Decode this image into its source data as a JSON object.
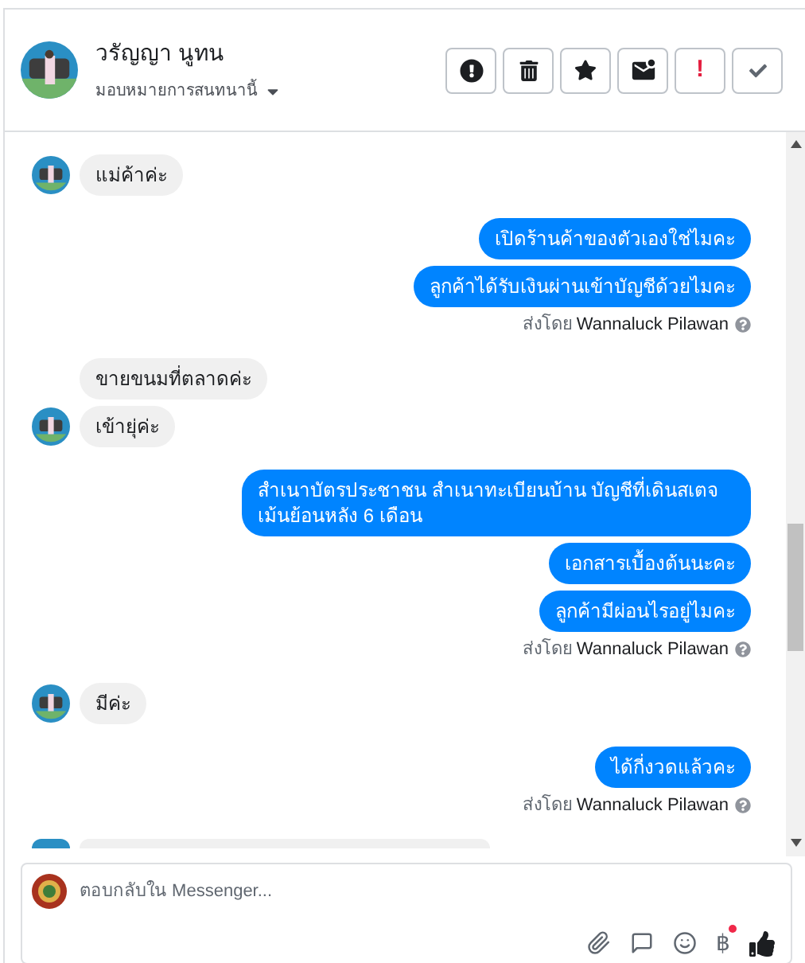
{
  "header": {
    "name": "วรัญญา นูทน",
    "assign_label": "มอบหมายการสนทนานี้",
    "actions": [
      {
        "kind": "alert"
      },
      {
        "kind": "trash"
      },
      {
        "kind": "star"
      },
      {
        "kind": "mail"
      },
      {
        "kind": "spam",
        "text": "!"
      },
      {
        "kind": "done"
      }
    ]
  },
  "messages": [
    {
      "kind": "incoming",
      "text": "แม่ค้าค่ะ",
      "avatar": true
    },
    {
      "kind": "outgoing",
      "text": "เปิดร้านค้าของตัวเองใช่ไมคะ"
    },
    {
      "kind": "outgoing",
      "text": "ลูกค้าได้รับเงินผ่านเข้าบัญชีด้วยไมคะ"
    },
    {
      "kind": "sent_by",
      "prefix": "ส่งโดย",
      "name": "Wannaluck Pilawan"
    },
    {
      "kind": "incoming",
      "text": "ขายขนมที่ตลาดค่ะ",
      "avatar": false
    },
    {
      "kind": "incoming",
      "text": "เข้ายุ่ค่ะ",
      "avatar": true
    },
    {
      "kind": "outgoing",
      "text": "สำเนาบัตรประชาชน   สำเนาทะเบียนบ้าน  บัญชีที่เดินสเตจ เม้นย้อนหลัง 6 เดือน"
    },
    {
      "kind": "outgoing",
      "text": "เอกสารเบื้องต้นนะคะ"
    },
    {
      "kind": "outgoing",
      "text": "ลูกค้ามีผ่อนไรอยู่ไมคะ"
    },
    {
      "kind": "sent_by",
      "prefix": "ส่งโดย",
      "name": "Wannaluck Pilawan"
    },
    {
      "kind": "incoming",
      "text": "มีค่ะ",
      "avatar": true
    },
    {
      "kind": "outgoing",
      "text": "ได้กี่งวดแล้วคะ"
    },
    {
      "kind": "sent_by",
      "prefix": "ส่งโดย",
      "name": "Wannaluck Pilawan"
    },
    {
      "kind": "incoming_cut",
      "avatar": true
    }
  ],
  "composer": {
    "placeholder": "ตอบกลับใน Messenger...",
    "currency": "฿",
    "currency_dot": true
  }
}
